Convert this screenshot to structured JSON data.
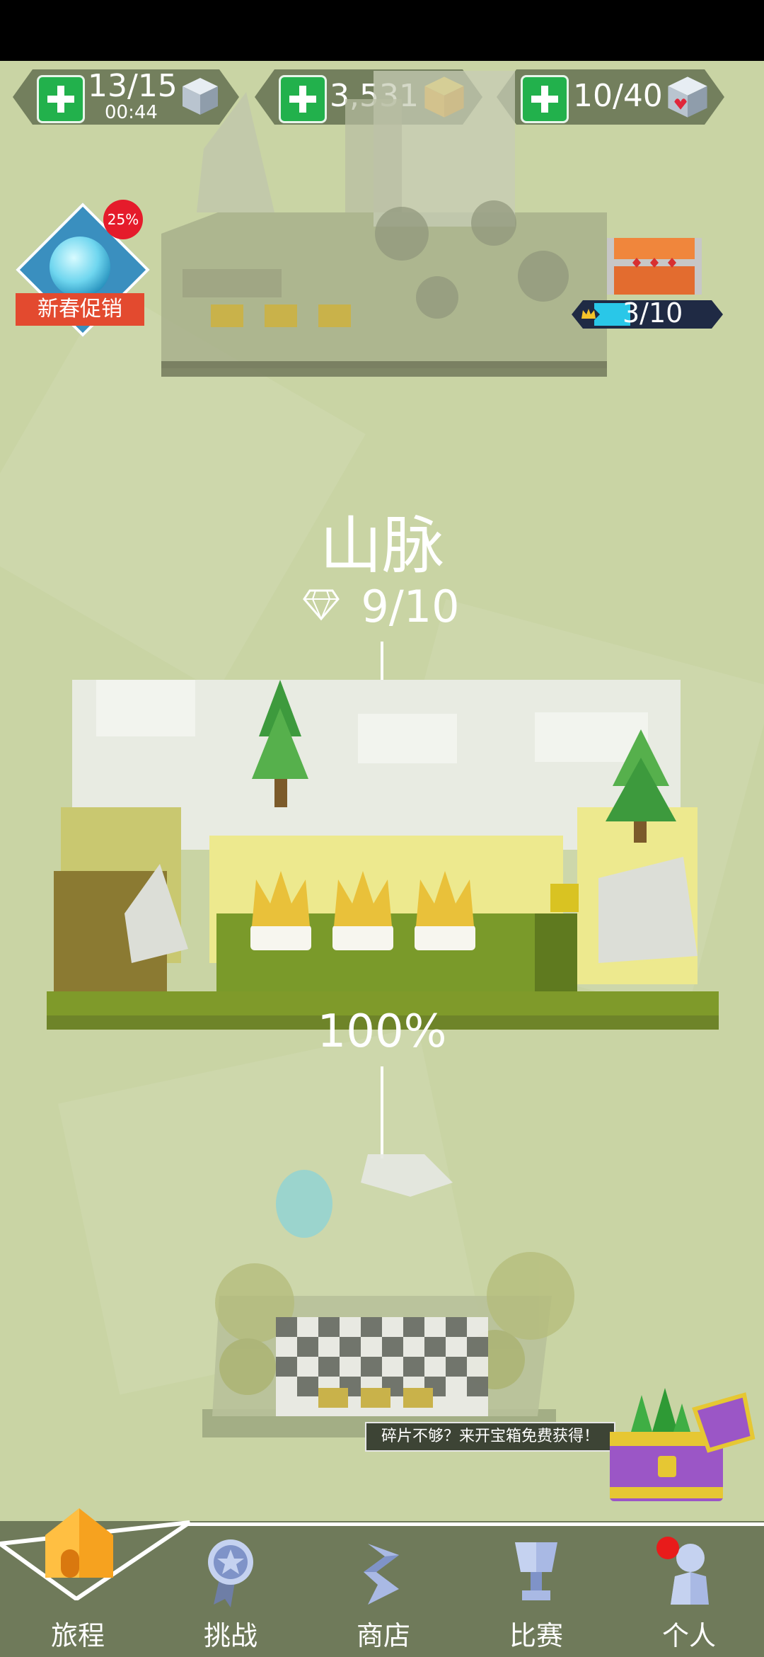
{
  "resources": {
    "lives": {
      "value": "13/15",
      "timer": "00:44"
    },
    "coins": {
      "value": "3,531"
    },
    "hearts": {
      "value": "10/40"
    }
  },
  "promo": {
    "label": "新春促销",
    "discount": "25%"
  },
  "chest": {
    "progress_text": "3/10",
    "progress_fraction": 0.3
  },
  "level": {
    "title": "山脉",
    "gems": "9/10",
    "progress": "100%"
  },
  "tooltip": "碎片不够？来开宝箱免费获得！",
  "nav": {
    "journey": "旅程",
    "challenge": "挑战",
    "shop": "商店",
    "match": "比赛",
    "profile": "个人"
  },
  "colors": {
    "accent": "#22b14c",
    "background": "#c9d4a4",
    "nav": "#6f7a5a"
  }
}
